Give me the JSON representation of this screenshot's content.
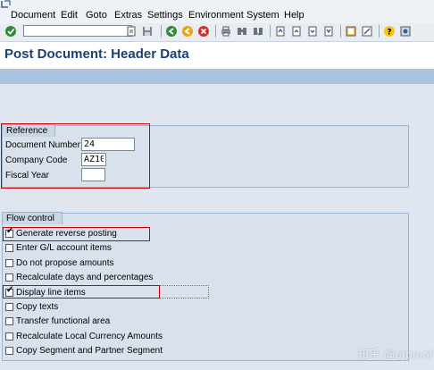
{
  "menu": [
    "Document",
    "Edit",
    "Goto",
    "Extras",
    "Settings",
    "Environment",
    "System",
    "Help"
  ],
  "toolbar": {
    "command_field": ""
  },
  "page_title": "Post Document: Header Data",
  "reference": {
    "title": "Reference",
    "fields": [
      {
        "label": "Document Number",
        "value": "24"
      },
      {
        "label": "Company Code",
        "value": "AZ10"
      },
      {
        "label": "Fiscal Year",
        "value": ""
      }
    ]
  },
  "flow_control": {
    "title": "Flow control",
    "options": [
      {
        "label": "Generate reverse posting",
        "checked": true
      },
      {
        "label": "Enter G/L account items",
        "checked": false
      },
      {
        "label": "Do not propose amounts",
        "checked": false
      },
      {
        "label": "Recalculate days and percentages",
        "checked": false
      },
      {
        "label": "Display line items",
        "checked": true
      },
      {
        "label": "Copy texts",
        "checked": false
      },
      {
        "label": "Transfer functional area",
        "checked": false
      },
      {
        "label": "Recalculate Local Currency Amounts",
        "checked": false
      },
      {
        "label": "Copy Segment and Partner Segment",
        "checked": false
      }
    ]
  },
  "watermark": "知乎 @erproof"
}
